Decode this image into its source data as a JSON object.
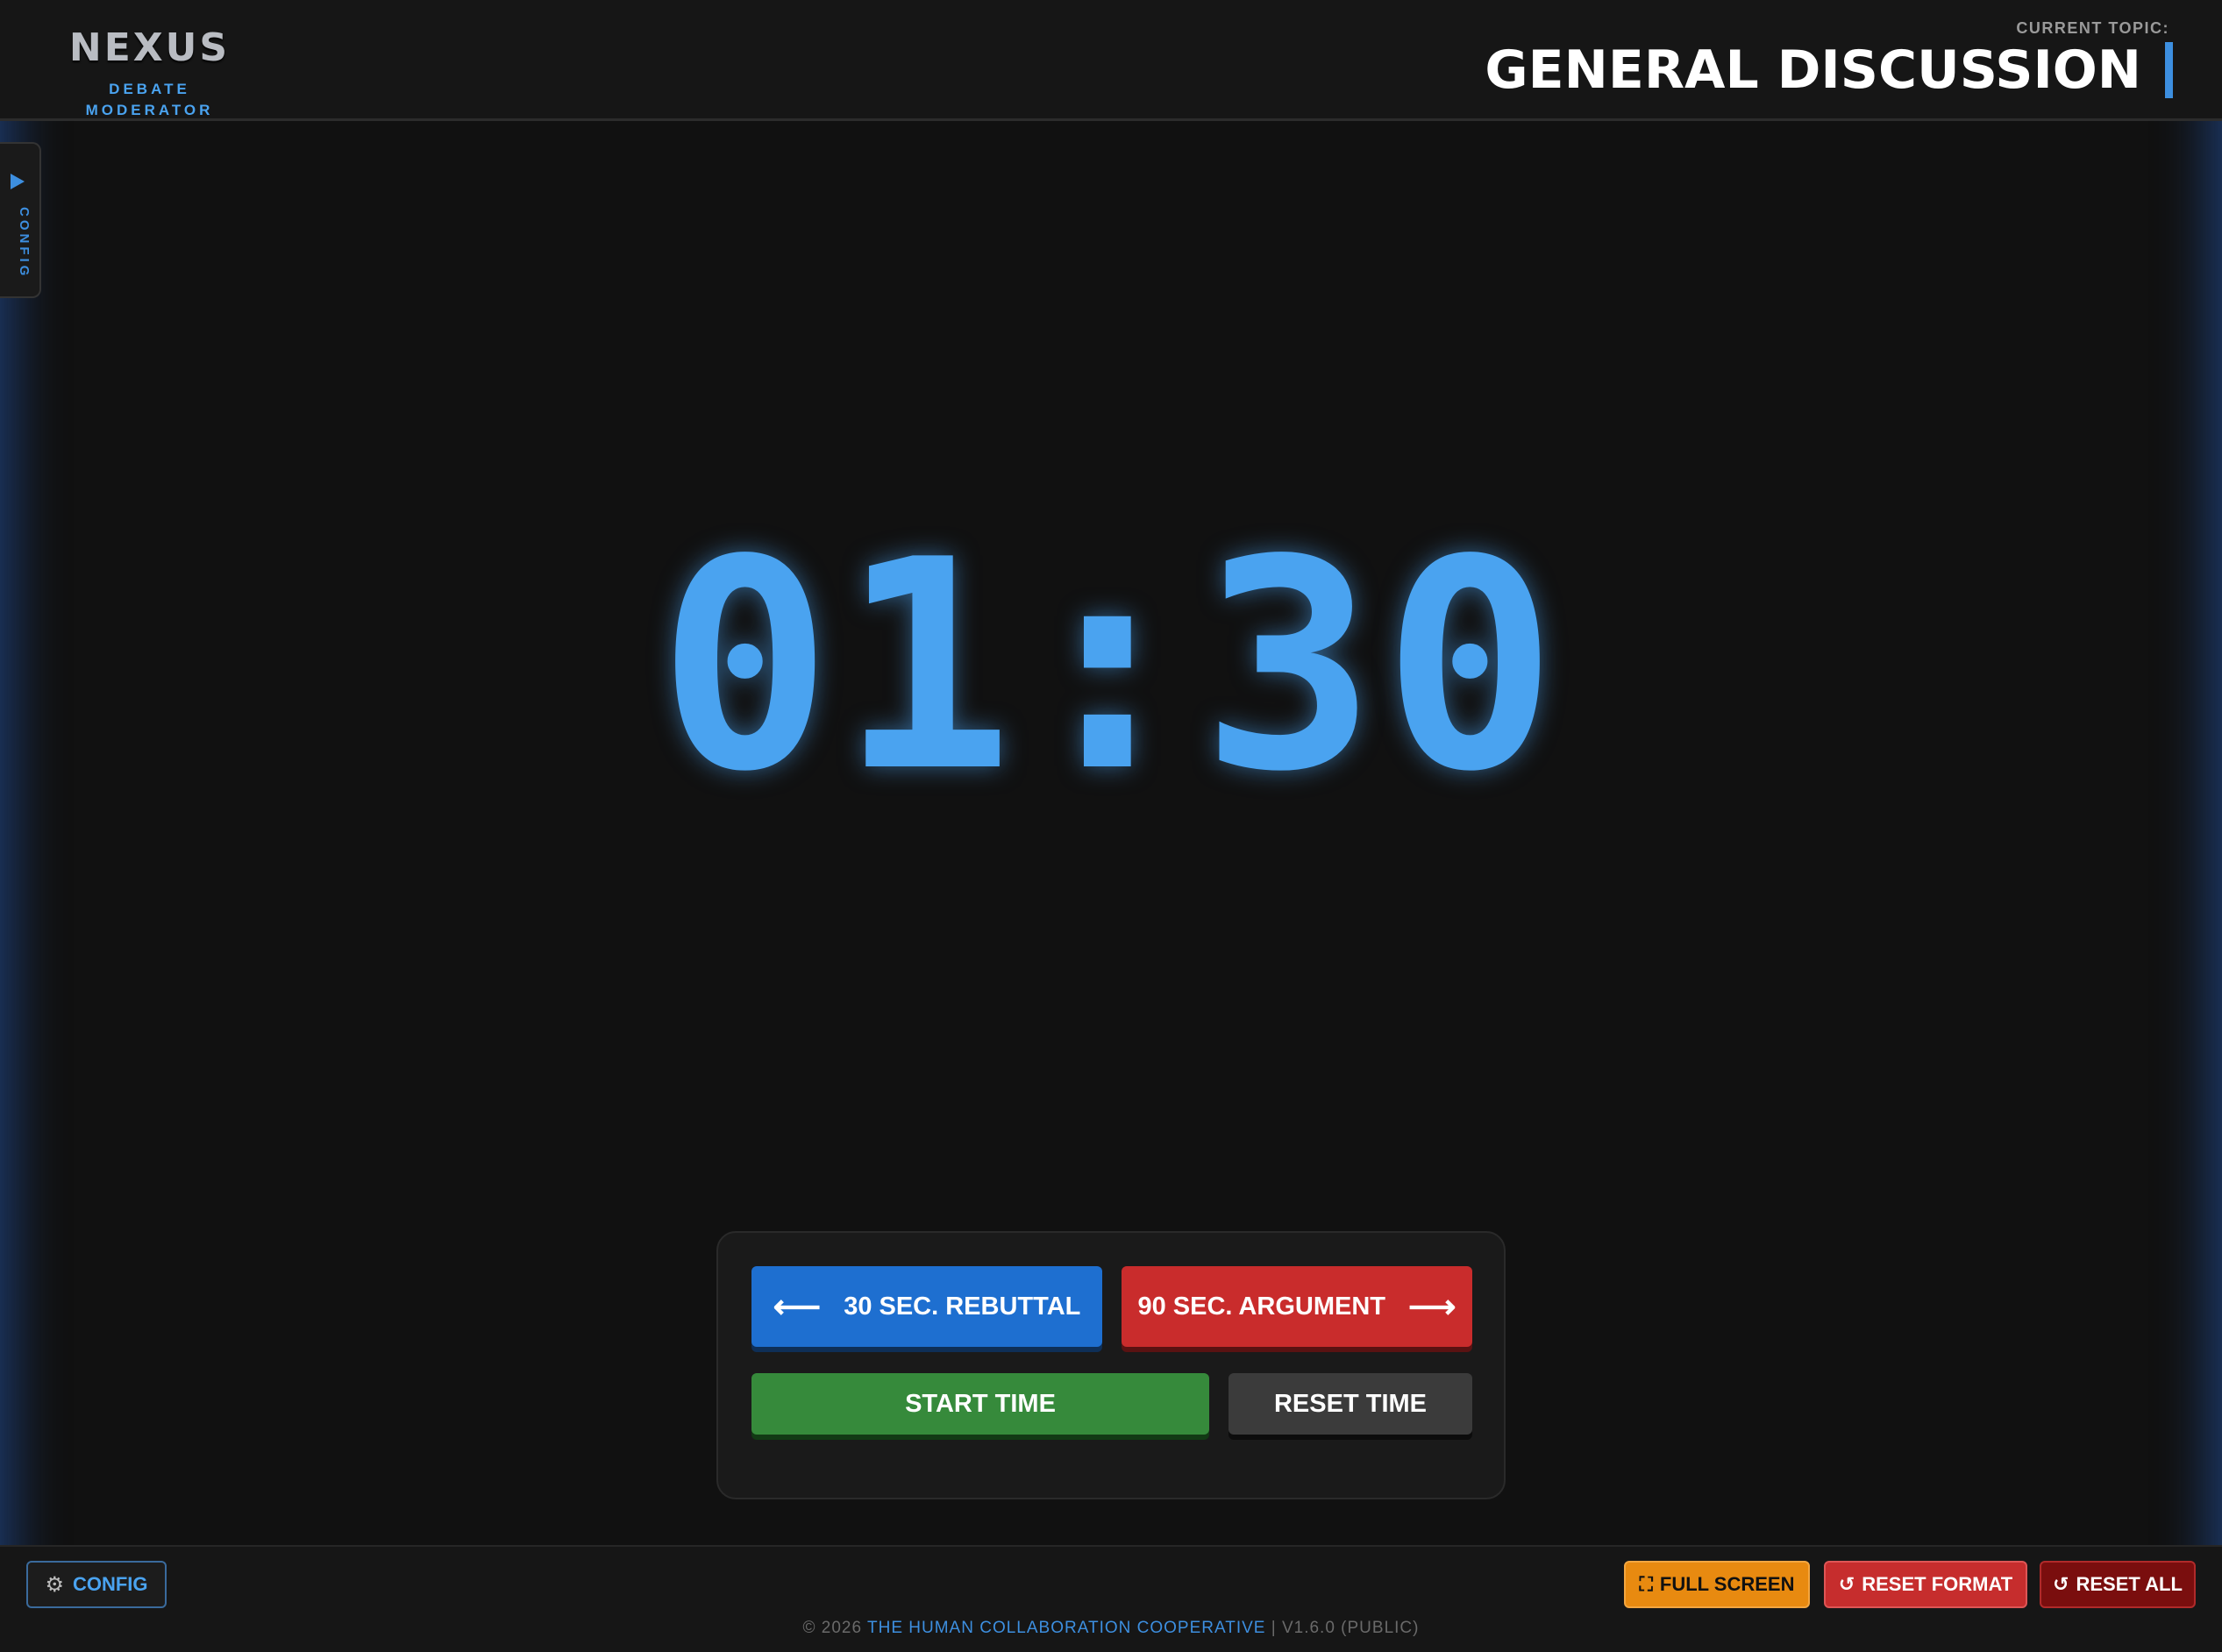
{
  "app": {
    "logo_text": "NEXUS",
    "logo_subtitle": "DEBATE MODERATOR"
  },
  "topic": {
    "label": "CURRENT TOPIC:",
    "title": "GENERAL DISCUSSION"
  },
  "side_tab": {
    "label": "CONFIG"
  },
  "timer": {
    "display": "01:30"
  },
  "controls": {
    "rebuttal_label": "30 SEC. REBUTTAL",
    "rebuttal_arrow": "⟵",
    "argument_label": "90 SEC. ARGUMENT",
    "argument_arrow": "⟶",
    "start_label": "START TIME",
    "reset_label": "RESET TIME"
  },
  "footer": {
    "config_label": "CONFIG",
    "full_screen_label": "FULL SCREEN",
    "reset_format_label": "RESET FORMAT",
    "reset_all_label": "RESET ALL",
    "copyright_prefix": "© 2026",
    "copyright_org": "THE HUMAN COLLABORATION COOPERATIVE",
    "copyright_suffix": "| V1.6.0 (PUBLIC)"
  },
  "colors": {
    "accent": "#4aa3f0",
    "rebuttal": "#1e6fd0",
    "argument": "#c92c2c",
    "start": "#368a3b",
    "full_screen": "#e88a10",
    "reset_all": "#7a0e0e"
  }
}
